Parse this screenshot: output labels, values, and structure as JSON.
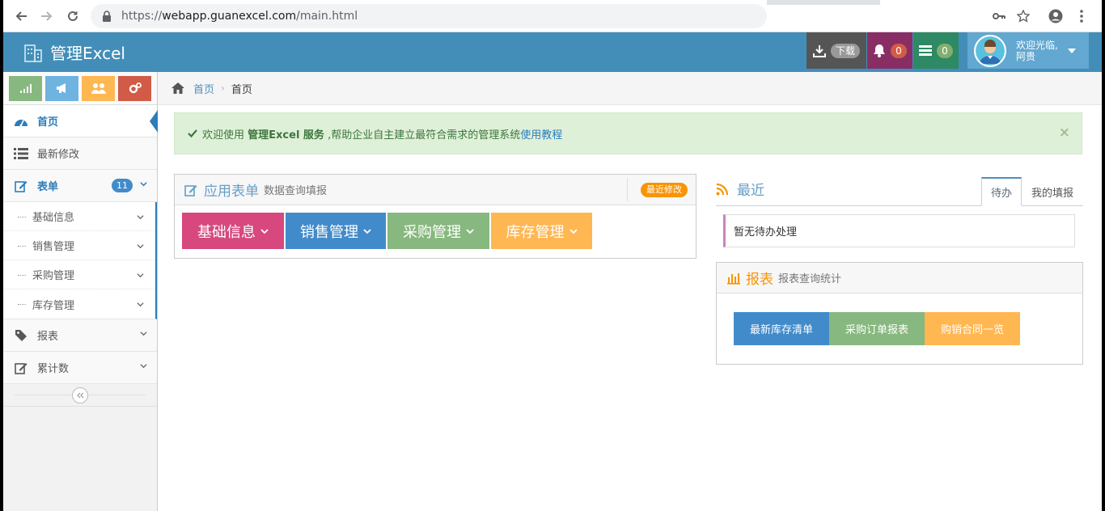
{
  "browser": {
    "url_protocol": "https://",
    "url_host": "webapp.guanexcel.com",
    "url_path": "/main.html"
  },
  "header": {
    "brand": "管理Excel",
    "download_label": "下载",
    "notifications_count": "0",
    "messages_count": "0",
    "user_greeting": "欢迎光临,",
    "user_name": "阿贵"
  },
  "colors": {
    "header": "#438eb9",
    "download_bg": "#555555",
    "notify_bg": "#892e65",
    "messages_bg": "#2e8965",
    "user_bg": "#62a8d1"
  },
  "sidebar": {
    "items": [
      {
        "label": "首页",
        "icon": "dashboard-icon"
      },
      {
        "label": "最新修改",
        "icon": "list-icon"
      },
      {
        "label": "表单",
        "icon": "edit-icon",
        "badge": "11"
      },
      {
        "label": "报表",
        "icon": "tag-icon"
      },
      {
        "label": "累计数",
        "icon": "edit-icon"
      }
    ],
    "submenu": [
      {
        "label": "基础信息"
      },
      {
        "label": "销售管理"
      },
      {
        "label": "采购管理"
      },
      {
        "label": "库存管理"
      }
    ]
  },
  "breadcrumb": {
    "home": "首页",
    "current": "首页"
  },
  "alert": {
    "prefix": "欢迎使用",
    "product": "管理Excel 服务",
    "middle": ",帮助企业自主建立最符合需求的管理系统",
    "link": "使用教程",
    "close": "×"
  },
  "app_form": {
    "title": "应用表单",
    "subtitle": "数据查询填报",
    "badge": "最近修改",
    "buttons": [
      {
        "label": "基础信息",
        "color": "#d6487e"
      },
      {
        "label": "销售管理",
        "color": "#428bca"
      },
      {
        "label": "采购管理",
        "color": "#87b87f"
      },
      {
        "label": "库存管理",
        "color": "#ffb752"
      }
    ]
  },
  "recent": {
    "title": "最近",
    "tabs": [
      "待办",
      "我的填报"
    ],
    "empty_text": "暂无待办处理"
  },
  "report": {
    "title": "报表",
    "subtitle": "报表查询统计",
    "buttons": [
      {
        "label": "最新库存清单",
        "color": "#428bca"
      },
      {
        "label": "采购订单报表",
        "color": "#87b87f"
      },
      {
        "label": "购销合同一览",
        "color": "#ffb752"
      }
    ]
  }
}
